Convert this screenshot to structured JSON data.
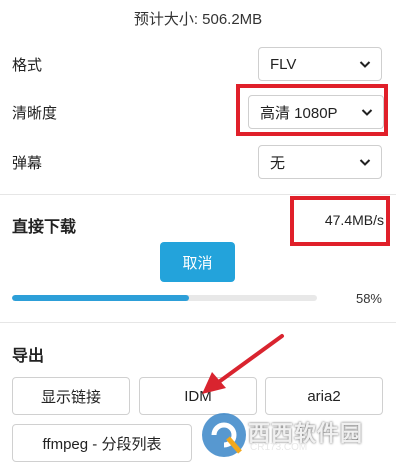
{
  "estimate": {
    "label": "预计大小: 506.2MB"
  },
  "fields": [
    {
      "label": "格式",
      "value": "FLV"
    },
    {
      "label": "清晰度",
      "value": "高清 1080P"
    },
    {
      "label": "弹幕",
      "value": "无"
    }
  ],
  "download": {
    "title": "直接下载",
    "speed": "47.4MB/s",
    "cancel_label": "取消",
    "progress_fraction": 0.58,
    "progress_text": "58%"
  },
  "export": {
    "title": "导出",
    "buttons": [
      "显示链接",
      "IDM",
      "aria2",
      "ffmpeg - 分段列表"
    ]
  },
  "watermark": {
    "name": "西西软件园",
    "url": "CR173.COM"
  },
  "colors": {
    "accent": "#23a3db",
    "highlight": "#e0202a",
    "arrow": "#d9242f"
  },
  "icons": {
    "select_arrow": "chevron-down-icon",
    "pointer": "arrow-pointer-icon"
  }
}
